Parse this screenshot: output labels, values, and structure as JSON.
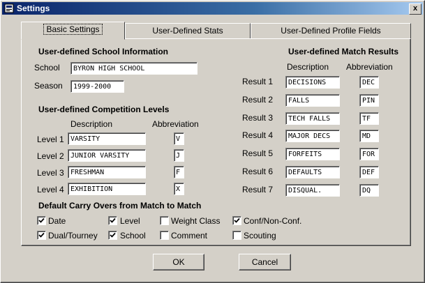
{
  "window": {
    "title": "Settings",
    "close_glyph": "x"
  },
  "tabs": [
    {
      "label": "Basic Settings"
    },
    {
      "label": "User-Defined Stats"
    },
    {
      "label": "User-Defined Profile Fields"
    }
  ],
  "school": {
    "header": "User-defined School Information",
    "school_label": "School",
    "school_value": "BYRON HIGH SCHOOL",
    "season_label": "Season",
    "season_value": "1999-2000"
  },
  "levels": {
    "header": "User-defined Competition Levels",
    "description_header": "Description",
    "abbreviation_header": "Abbreviation",
    "items": [
      {
        "label": "Level 1",
        "description": "VARSITY",
        "abbr": "V"
      },
      {
        "label": "Level 2",
        "description": "JUNIOR VARSITY",
        "abbr": "J"
      },
      {
        "label": "Level 3",
        "description": "FRESHMAN",
        "abbr": "F"
      },
      {
        "label": "Level 4",
        "description": "EXHIBITION",
        "abbr": "X"
      }
    ]
  },
  "results": {
    "header": "User-defined Match Results",
    "description_header": "Description",
    "abbreviation_header": "Abbreviation",
    "items": [
      {
        "label": "Result 1",
        "description": "DECISIONS",
        "abbr": "DEC"
      },
      {
        "label": "Result 2",
        "description": "FALLS",
        "abbr": "PIN"
      },
      {
        "label": "Result 3",
        "description": "TECH FALLS",
        "abbr": "TF"
      },
      {
        "label": "Result 4",
        "description": "MAJOR DECS",
        "abbr": "MD"
      },
      {
        "label": "Result 5",
        "description": "FORFEITS",
        "abbr": "FOR"
      },
      {
        "label": "Result 6",
        "description": "DEFAULTS",
        "abbr": "DEF"
      },
      {
        "label": "Result 7",
        "description": "DISQUAL.",
        "abbr": "DQ"
      }
    ]
  },
  "carryovers": {
    "header": "Default Carry Overs from Match to Match",
    "items": [
      {
        "label": "Date",
        "checked": true
      },
      {
        "label": "Level",
        "checked": true
      },
      {
        "label": "Weight Class",
        "checked": false
      },
      {
        "label": "Conf/Non-Conf.",
        "checked": true
      },
      {
        "label": "Dual/Tourney",
        "checked": true
      },
      {
        "label": "School",
        "checked": true
      },
      {
        "label": "Comment",
        "checked": false
      },
      {
        "label": "Scouting",
        "checked": false
      }
    ]
  },
  "buttons": {
    "ok": "OK",
    "cancel": "Cancel"
  },
  "icons": {
    "app": "settings-app-icon"
  }
}
